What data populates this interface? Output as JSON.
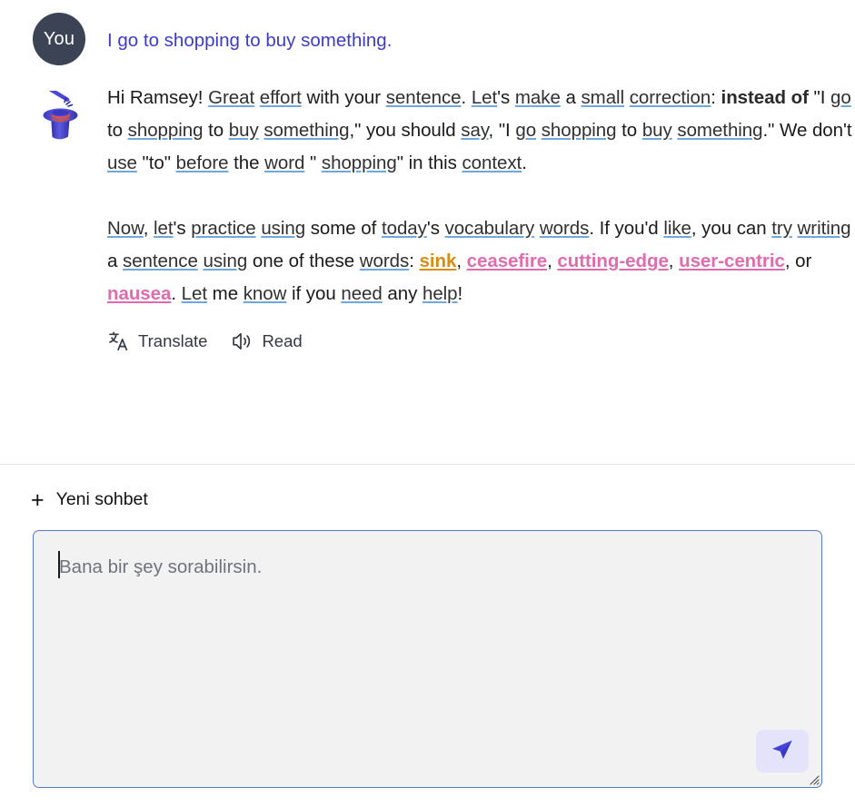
{
  "conversation": {
    "user": {
      "avatar_label": "You",
      "avatar_color": "#3b4354",
      "message": "I go to shopping to buy something.",
      "message_color": "#3c3cc8"
    },
    "assistant": {
      "avatar_icon": "magic-hat-and-wand-icon",
      "paragraph1": [
        {
          "text": "Hi Ramsey! ",
          "style": "plain"
        },
        {
          "text": "Great",
          "style": "link"
        },
        {
          "text": " ",
          "style": "plain"
        },
        {
          "text": "effort",
          "style": "link"
        },
        {
          "text": " with your ",
          "style": "plain"
        },
        {
          "text": "sentence",
          "style": "link"
        },
        {
          "text": ". ",
          "style": "plain"
        },
        {
          "text": "Let",
          "style": "link"
        },
        {
          "text": "'s ",
          "style": "plain"
        },
        {
          "text": "make",
          "style": "link"
        },
        {
          "text": " a ",
          "style": "plain"
        },
        {
          "text": "small",
          "style": "link"
        },
        {
          "text": " ",
          "style": "plain"
        },
        {
          "text": "correction",
          "style": "link"
        },
        {
          "text": ": ",
          "style": "plain"
        },
        {
          "text": "instead of",
          "style": "bold"
        },
        {
          "text": " \"I ",
          "style": "plain"
        },
        {
          "text": "go",
          "style": "link"
        },
        {
          "text": " to ",
          "style": "plain"
        },
        {
          "text": "shopping",
          "style": "link"
        },
        {
          "text": " to ",
          "style": "plain"
        },
        {
          "text": "buy",
          "style": "link"
        },
        {
          "text": " ",
          "style": "plain"
        },
        {
          "text": "something",
          "style": "link"
        },
        {
          "text": ",\" you should ",
          "style": "plain"
        },
        {
          "text": "say",
          "style": "link"
        },
        {
          "text": ", \"I ",
          "style": "plain"
        },
        {
          "text": "go",
          "style": "link"
        },
        {
          "text": " ",
          "style": "plain"
        },
        {
          "text": "shopping",
          "style": "link"
        },
        {
          "text": " to ",
          "style": "plain"
        },
        {
          "text": "buy",
          "style": "link"
        },
        {
          "text": " ",
          "style": "plain"
        },
        {
          "text": "something",
          "style": "link"
        },
        {
          "text": ".\" We don't ",
          "style": "plain"
        },
        {
          "text": "use",
          "style": "link"
        },
        {
          "text": " \"to\" ",
          "style": "plain"
        },
        {
          "text": "before",
          "style": "link"
        },
        {
          "text": " the ",
          "style": "plain"
        },
        {
          "text": "word",
          "style": "link"
        },
        {
          "text": " \" ",
          "style": "plain"
        },
        {
          "text": "shopping",
          "style": "link"
        },
        {
          "text": "\" in this ",
          "style": "plain"
        },
        {
          "text": "context",
          "style": "link"
        },
        {
          "text": ".",
          "style": "plain"
        }
      ],
      "paragraph2": [
        {
          "text": "Now",
          "style": "link"
        },
        {
          "text": ", ",
          "style": "plain"
        },
        {
          "text": "let",
          "style": "link"
        },
        {
          "text": "'s ",
          "style": "plain"
        },
        {
          "text": "practice",
          "style": "link"
        },
        {
          "text": " ",
          "style": "plain"
        },
        {
          "text": "using",
          "style": "link"
        },
        {
          "text": " some of ",
          "style": "plain"
        },
        {
          "text": "today",
          "style": "link"
        },
        {
          "text": "'s ",
          "style": "plain"
        },
        {
          "text": "vocabulary",
          "style": "link"
        },
        {
          "text": " ",
          "style": "plain"
        },
        {
          "text": "words",
          "style": "link"
        },
        {
          "text": ". If you'd ",
          "style": "plain"
        },
        {
          "text": "like",
          "style": "link"
        },
        {
          "text": ", you can ",
          "style": "plain"
        },
        {
          "text": "try",
          "style": "link"
        },
        {
          "text": " ",
          "style": "plain"
        },
        {
          "text": "writing",
          "style": "link"
        },
        {
          "text": " a ",
          "style": "plain"
        },
        {
          "text": "sentence",
          "style": "link"
        },
        {
          "text": " ",
          "style": "plain"
        },
        {
          "text": "using",
          "style": "link"
        },
        {
          "text": " one of these ",
          "style": "plain"
        },
        {
          "text": "words",
          "style": "link"
        },
        {
          "text": ": ",
          "style": "plain"
        },
        {
          "text": "sink",
          "style": "vocab-orange"
        },
        {
          "text": ", ",
          "style": "plain"
        },
        {
          "text": "ceasefire",
          "style": "vocab-pink"
        },
        {
          "text": ", ",
          "style": "plain"
        },
        {
          "text": "cutting-edge",
          "style": "vocab-pink"
        },
        {
          "text": ", ",
          "style": "plain"
        },
        {
          "text": "user-centric",
          "style": "vocab-pink"
        },
        {
          "text": ", or ",
          "style": "plain"
        },
        {
          "text": "nausea",
          "style": "vocab-pink"
        },
        {
          "text": ". ",
          "style": "plain"
        },
        {
          "text": "Let",
          "style": "link"
        },
        {
          "text": " me ",
          "style": "plain"
        },
        {
          "text": "know",
          "style": "link"
        },
        {
          "text": " if you ",
          "style": "plain"
        },
        {
          "text": "need",
          "style": "link"
        },
        {
          "text": " any ",
          "style": "plain"
        },
        {
          "text": "help",
          "style": "link"
        },
        {
          "text": "!",
          "style": "plain"
        }
      ],
      "vocabulary_words": [
        "sink",
        "ceasefire",
        "cutting-edge",
        "user-centric",
        "nausea"
      ],
      "vocab_colors": {
        "orange": "#d98c12",
        "pink": "#e06cb0"
      },
      "actions": [
        {
          "label": "Translate",
          "icon": "translate-icon"
        },
        {
          "label": "Read",
          "icon": "speaker-icon"
        }
      ]
    }
  },
  "composer": {
    "new_chat_label": "Yeni sohbet",
    "new_chat_icon": "plus-icon",
    "input_placeholder": "Bana bir şey sorabilirsin.",
    "input_value": "",
    "send_icon": "send-paper-plane-icon",
    "send_icon_color": "#4543d6",
    "border_color": "#5878c8"
  }
}
